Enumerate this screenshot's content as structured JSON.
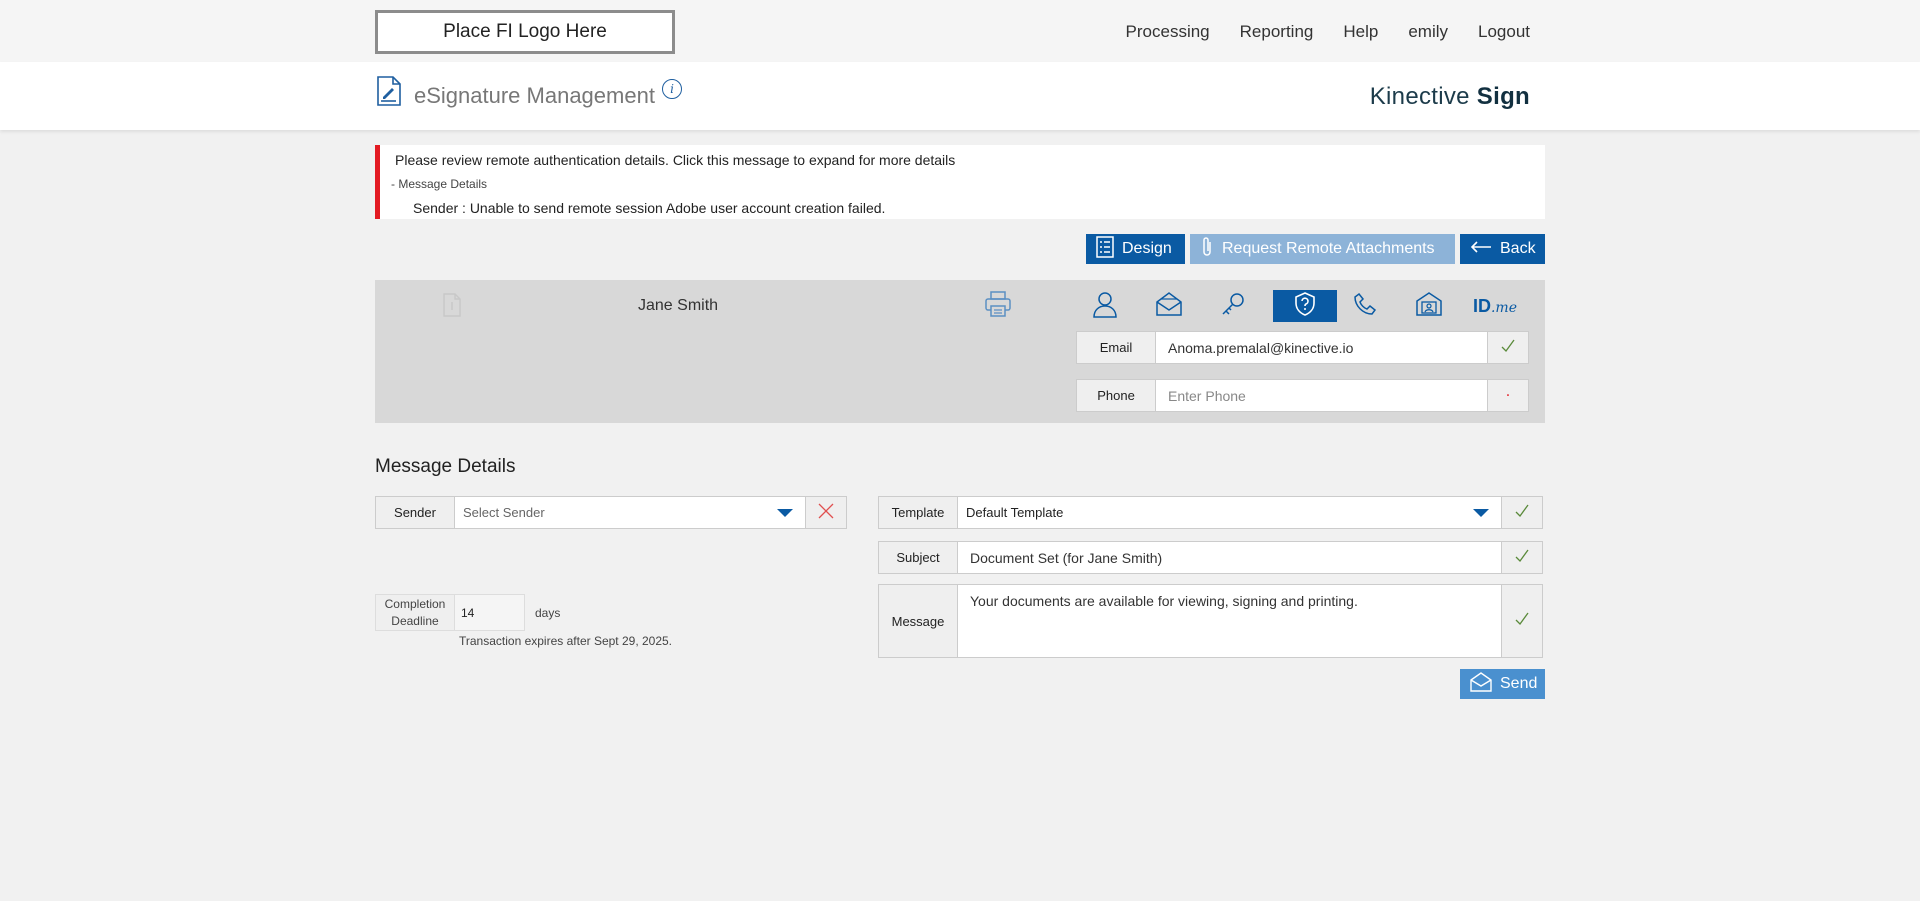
{
  "topbar": {
    "logo_text": "Place FI Logo Here",
    "nav": [
      "Processing",
      "Reporting",
      "Help",
      "emily",
      "Logout"
    ]
  },
  "header": {
    "title": "eSignature Management",
    "info_glyph": "i",
    "brand_light": "Kinective",
    "brand_bold": "Sign"
  },
  "alert": {
    "message": "Please review remote authentication details. Click this message to expand for more details",
    "toggle_label": "- Message Details",
    "detail": "Sender :  Unable to send remote session Adobe user account creation failed.",
    "color": "#e31b23"
  },
  "actions": {
    "design_label": "Design",
    "remote_label": "Request Remote Attachments",
    "back_label": "Back"
  },
  "signer": {
    "name": "Jane Smith",
    "auth_methods": [
      "person-icon",
      "mail-icon",
      "key-icon",
      "shield-question-icon",
      "phone-icon",
      "id-card-icon",
      "idme-logo"
    ],
    "active_auth_method": "shield-question-icon",
    "idme_label": "ID",
    "idme_suffix": ".me",
    "email_label": "Email",
    "email_value": "Anoma.premalal@kinective.io",
    "phone_label": "Phone",
    "phone_placeholder": "Enter Phone",
    "required_glyph": "·"
  },
  "message_details": {
    "title": "Message Details",
    "sender_label": "Sender",
    "sender_placeholder": "Select Sender",
    "deadline_label_1": "Completion",
    "deadline_label_2": "Deadline",
    "deadline_value": "14",
    "deadline_unit": "days",
    "expire_note": "Transaction expires after Sept 29, 2025.",
    "template_label": "Template",
    "template_value": "Default Template",
    "subject_label": "Subject",
    "subject_value": "Document Set (for Jane Smith)",
    "message_label": "Message",
    "message_value": "Your documents are available for viewing, signing and printing.",
    "send_label": "Send"
  },
  "colors": {
    "primary": "#0a5aa3",
    "primary_light": "#8db3d8",
    "send": "#4a90cf",
    "check": "#5a8a3a",
    "error": "#e31b23"
  }
}
